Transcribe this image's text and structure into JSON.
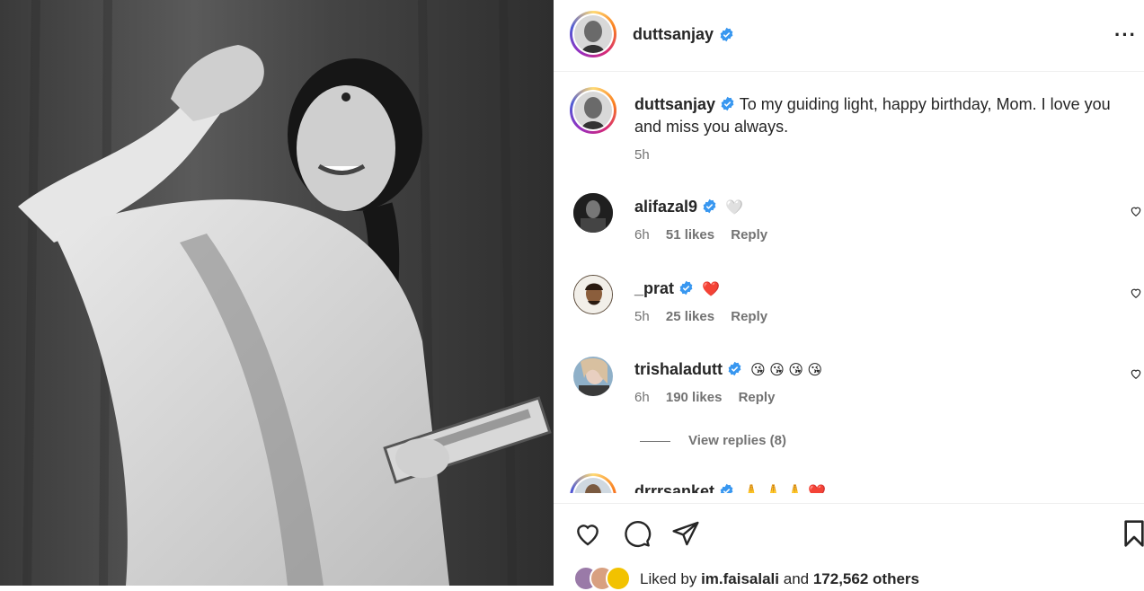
{
  "post": {
    "author": "duttsanjay",
    "caption": "To my guiding light, happy birthday, Mom. I love you and miss you always.",
    "caption_time": "5h",
    "more_label": "···"
  },
  "comments": [
    {
      "user": "alifazal9",
      "emoji": "🤍",
      "time": "6h",
      "likes": "51 likes",
      "reply": "Reply"
    },
    {
      "user": "_prat",
      "emoji": "❤️",
      "time": "5h",
      "likes": "25 likes",
      "reply": "Reply"
    },
    {
      "user": "trishaladutt",
      "emoji": "😘 😘 😘 😘",
      "time": "6h",
      "likes": "190 likes",
      "reply": "Reply",
      "view_replies": "View replies (8)"
    },
    {
      "user": "drrrsanket",
      "emoji": "🙏 🙏 🙏 ❤️"
    }
  ],
  "liked_by": {
    "prefix": "Liked by",
    "user": "im.faisalali",
    "conj": "and",
    "others": "172,562 others"
  },
  "icons": {
    "like": "heart-icon",
    "comment": "comment-bubble-icon",
    "share": "paper-plane-icon",
    "save": "bookmark-icon",
    "verified": "verified-badge-icon"
  },
  "colors": {
    "verified": "#3897f0",
    "heart_red": "#ff3040",
    "muted": "#737373"
  }
}
